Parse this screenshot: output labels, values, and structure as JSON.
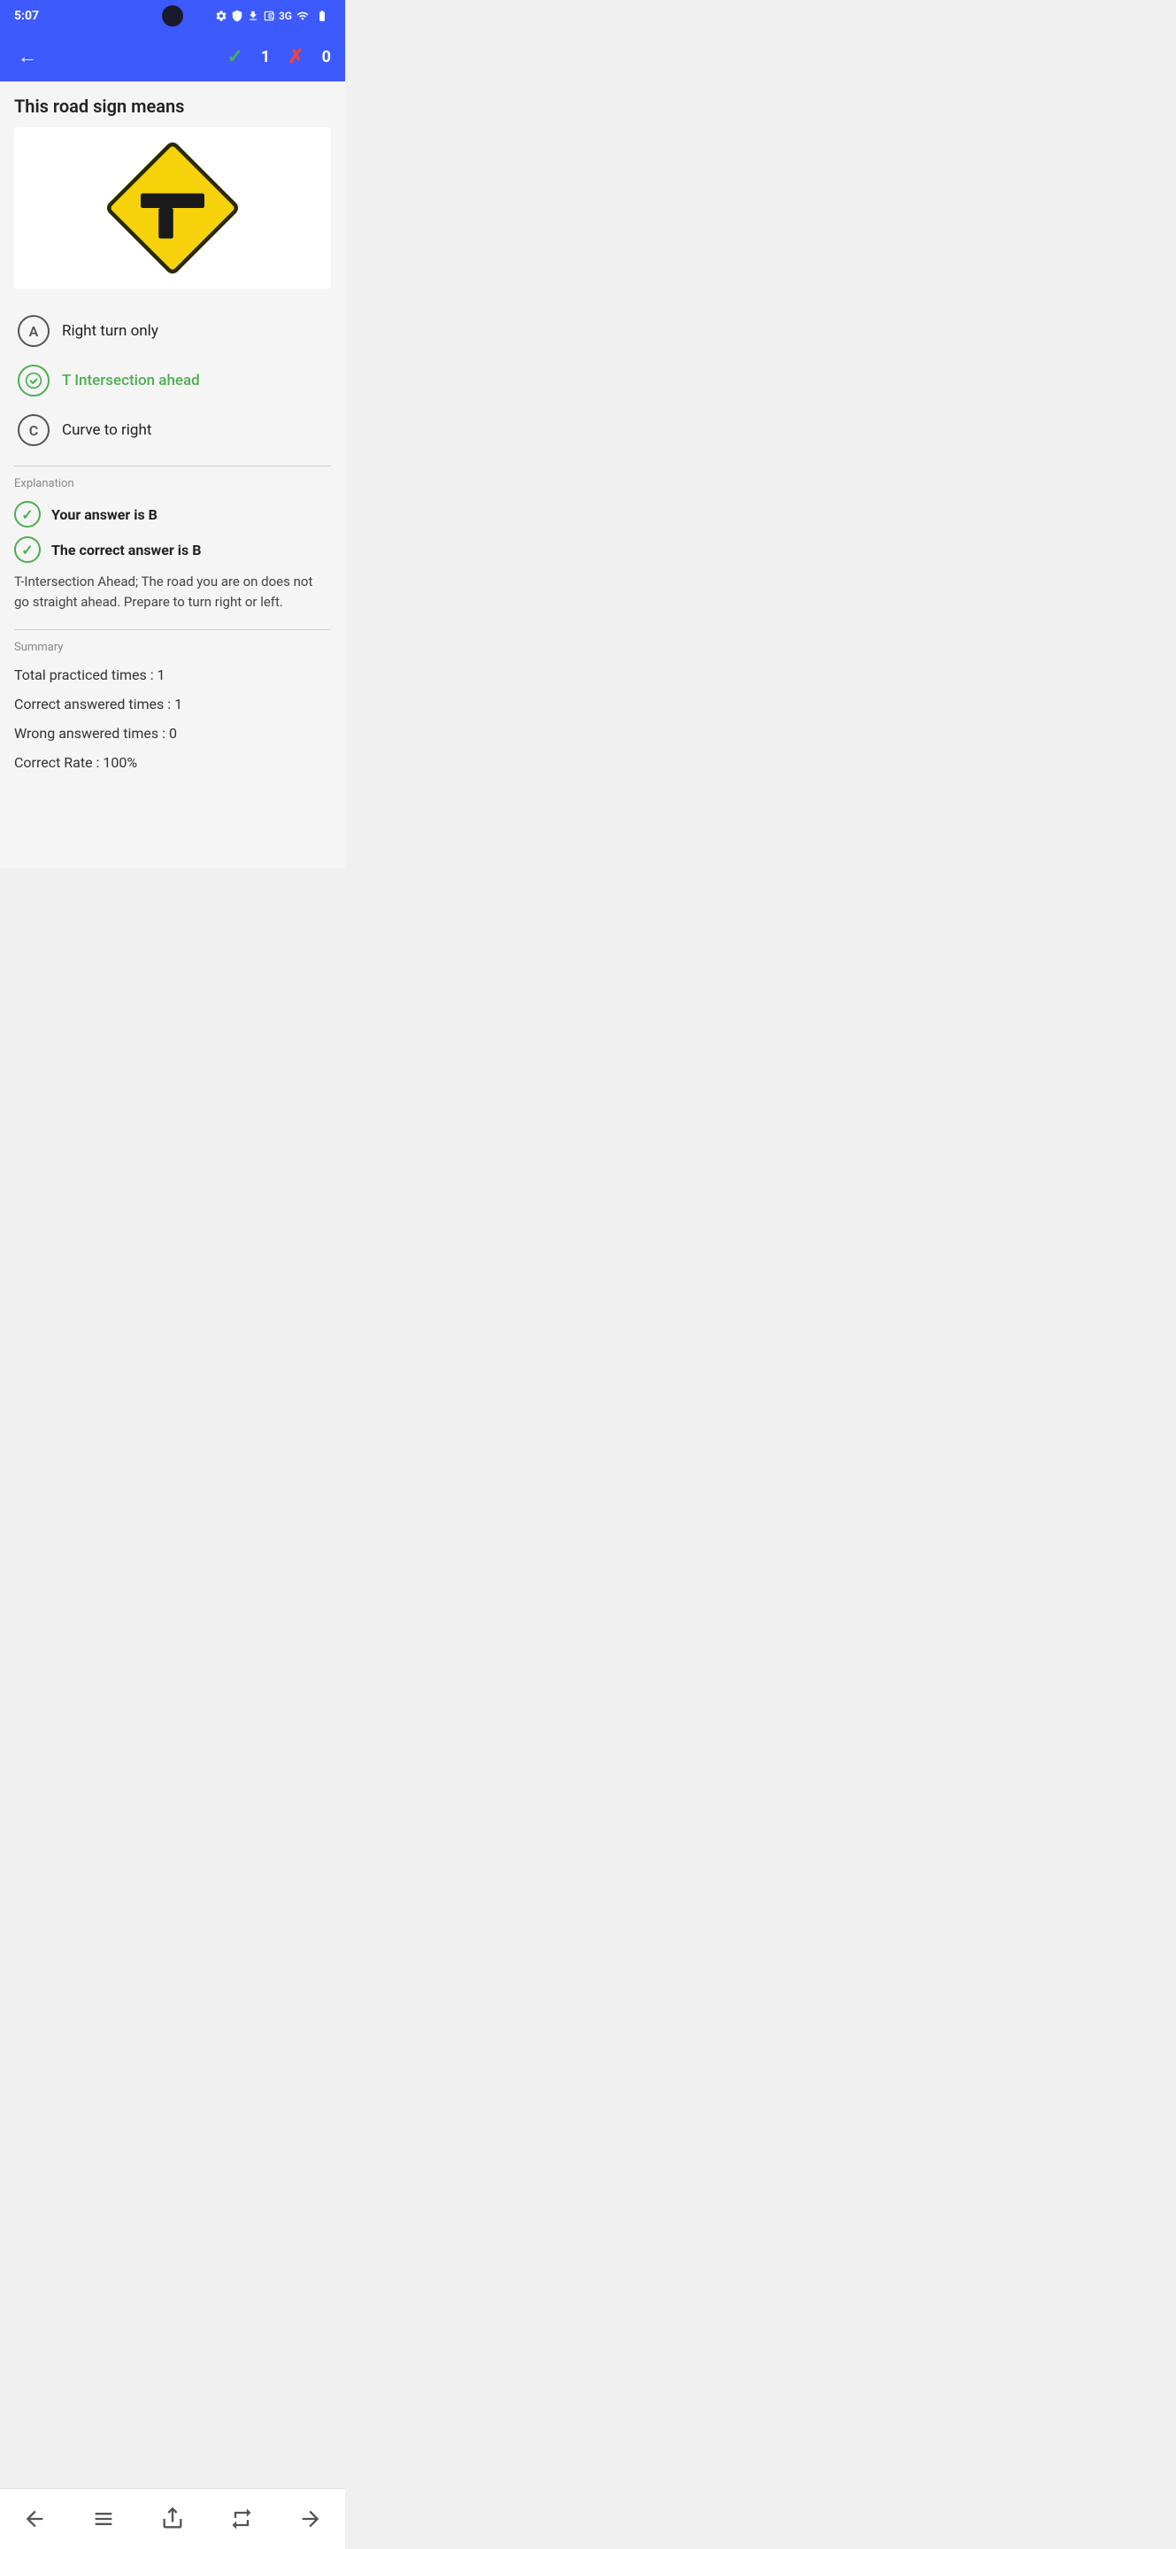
{
  "statusBar": {
    "time": "5:07",
    "network": "3G"
  },
  "navBar": {
    "backLabel": "←",
    "correctCount": "1",
    "wrongCount": "0"
  },
  "question": {
    "title": "This road sign means"
  },
  "options": [
    {
      "id": "A",
      "label": "Right turn only",
      "state": "normal"
    },
    {
      "id": "B",
      "label": "T Intersection ahead",
      "state": "correct"
    },
    {
      "id": "C",
      "label": "Curve to right",
      "state": "normal"
    }
  ],
  "explanation": {
    "sectionTitle": "Explanation",
    "yourAnswer": "Your answer is B",
    "correctAnswer": "The correct answer is B",
    "text": "T-Intersection Ahead; The road you are on does not go straight ahead. Prepare to turn right or left."
  },
  "summary": {
    "sectionTitle": "Summary",
    "totalPracticed": "Total practiced times : 1",
    "correctAnswered": "Correct answered times : 1",
    "wrongAnswered": "Wrong answered times : 0",
    "correctRate": "Correct Rate : 100%"
  },
  "bottomNav": {
    "prev": "prev",
    "home": "home",
    "share": "share",
    "repeat": "repeat",
    "next": "next"
  }
}
